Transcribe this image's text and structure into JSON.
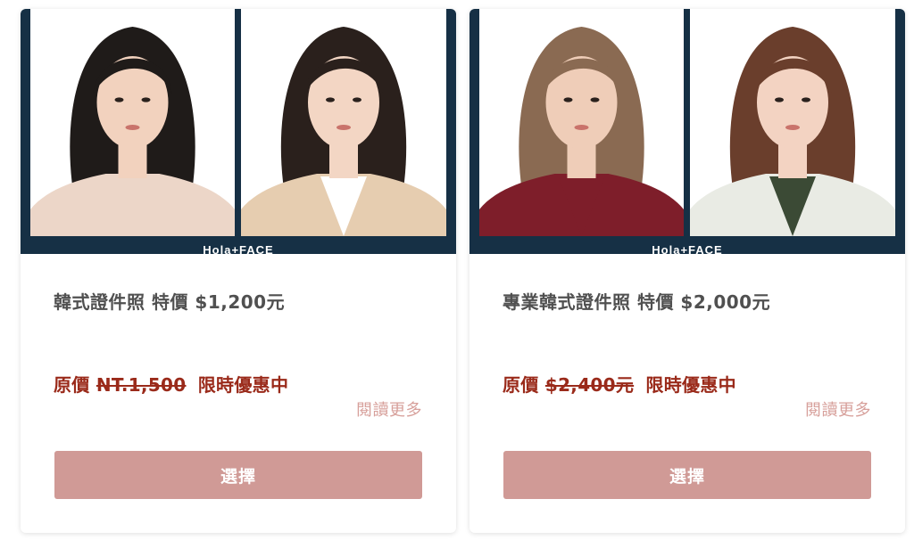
{
  "cards": [
    {
      "brand": "Hola+FACE",
      "title": "韓式證件照 特價 $1,200元",
      "promo_prefix": "原價",
      "promo_original_price": "NT.1,500",
      "promo_suffix": "限時優惠中",
      "read_more": "閱讀更多",
      "button": "選擇",
      "photos": [
        {
          "hair": "#1f1b19",
          "skin": "#f2d2be",
          "top": "#ecd6c8",
          "inner": "#ecd6c8"
        },
        {
          "hair": "#2a201c",
          "skin": "#f3d6c4",
          "top": "#e6cdb0",
          "inner": "#ffffff"
        }
      ]
    },
    {
      "brand": "Hola+FACE",
      "title": "專業韓式證件照 特價 $2,000元",
      "promo_prefix": "原價",
      "promo_original_price": "$2,400元",
      "promo_suffix": "限時優惠中",
      "read_more": "閱讀更多",
      "button": "選擇",
      "photos": [
        {
          "hair": "#8a6a52",
          "skin": "#efcdb8",
          "top": "#7e1e2a",
          "inner": "#7e1e2a"
        },
        {
          "hair": "#6a3e2c",
          "skin": "#f3d3c2",
          "top": "#e9ebe4",
          "inner": "#3b4a35"
        }
      ]
    }
  ],
  "colors": {
    "strip": "#163045",
    "title": "#505050",
    "promo": "#9a2a1a",
    "read_more": "#d7a09b",
    "button": "#d09a96"
  }
}
